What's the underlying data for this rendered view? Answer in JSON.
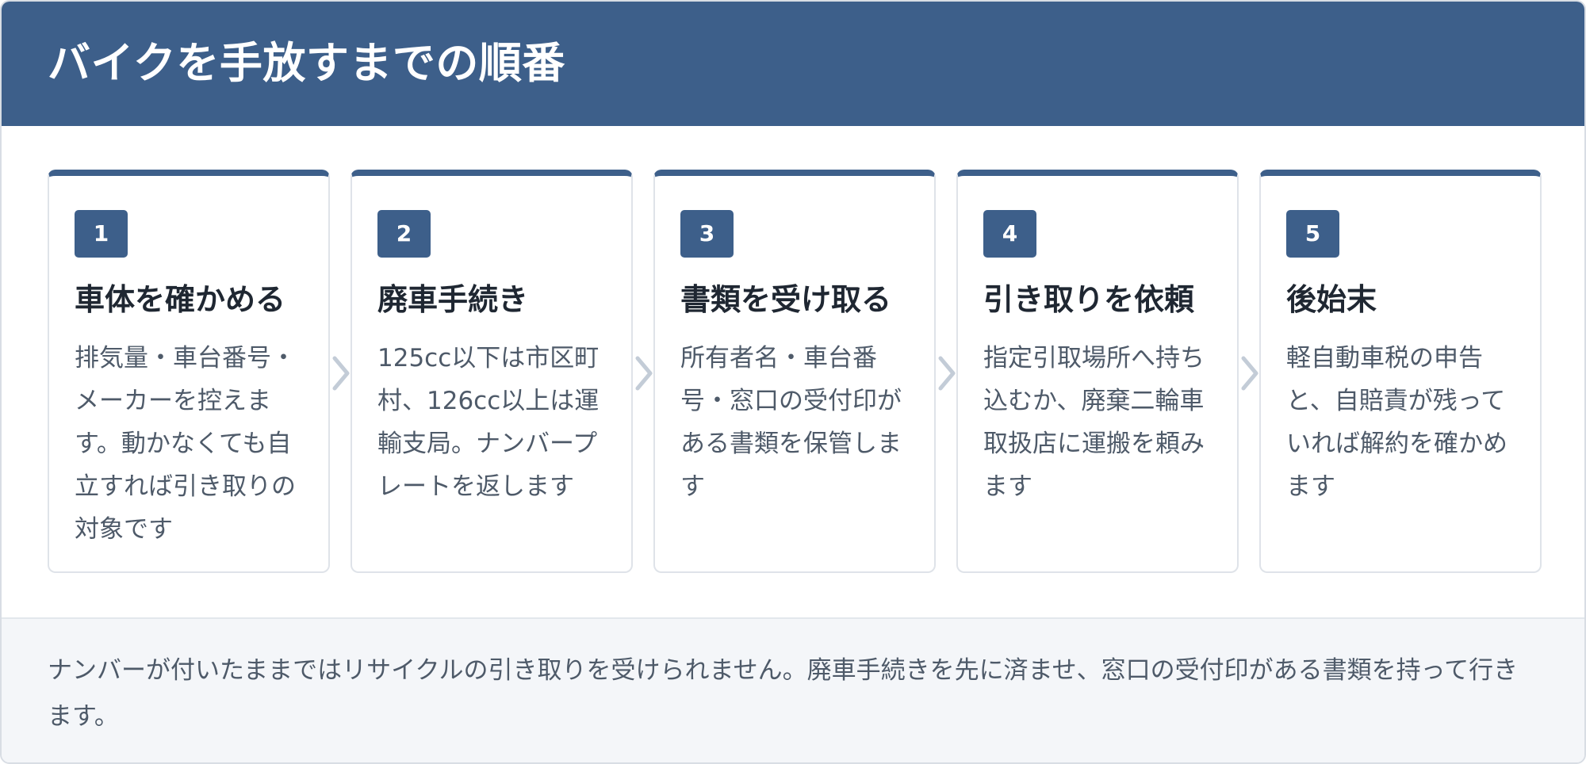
{
  "header": {
    "title": "バイクを手放すまでの順番"
  },
  "steps": [
    {
      "number": "1",
      "title": "車体を確かめる",
      "description": "排気量・車台番号・メーカーを控えます。動かなくても自立すれば引き取りの対象です"
    },
    {
      "number": "2",
      "title": "廃車手続き",
      "description": "125cc以下は市区町村、126cc以上は運輸支局。ナンバープレートを返します"
    },
    {
      "number": "3",
      "title": "書類を受け取る",
      "description": "所有者名・車台番号・窓口の受付印がある書類を保管します"
    },
    {
      "number": "4",
      "title": "引き取りを依頼",
      "description": "指定引取場所へ持ち込むか、廃棄二輪車取扱店に運搬を頼みます"
    },
    {
      "number": "5",
      "title": "後始末",
      "description": "軽自動車税の申告と、自賠責が残っていれば解約を確かめます"
    }
  ],
  "icons": {
    "step_separator": "chevron-right-icon"
  },
  "colors": {
    "header_background": "#3d5f8a",
    "accent": "#3d5f8a",
    "chevron": "#c3ccd7",
    "footer_background": "#f4f6f9"
  },
  "footer": {
    "note": "ナンバーが付いたままではリサイクルの引き取りを受けられません。廃車手続きを先に済ませ、窓口の受付印がある書類を持って行きます。"
  }
}
